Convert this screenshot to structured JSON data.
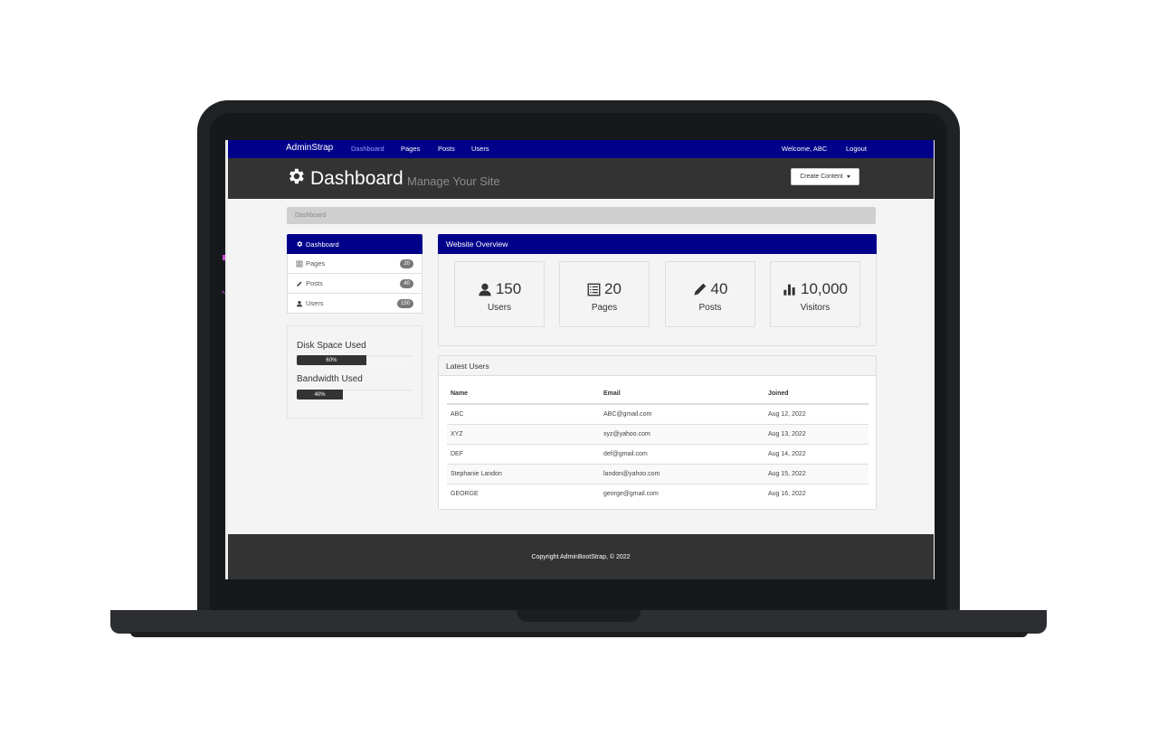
{
  "navbar": {
    "brand": "AdminStrap",
    "links": [
      "Dashboard",
      "Pages",
      "Posts",
      "Users"
    ],
    "welcome": "Welcome, ABC",
    "logout": "Logout"
  },
  "header": {
    "title": "Dashboard",
    "subtitle": "Manage Your Site",
    "create_button": "Create Content"
  },
  "breadcrumb": "Dashboard",
  "sidebar": {
    "items": [
      {
        "label": "Dashboard",
        "icon": "gear-icon"
      },
      {
        "label": "Pages",
        "icon": "list-icon",
        "badge": "20"
      },
      {
        "label": "Posts",
        "icon": "pencil-icon",
        "badge": "40"
      },
      {
        "label": "Users",
        "icon": "user-icon",
        "badge": "150"
      }
    ],
    "disk_label": "Disk Space Used",
    "disk_value": "60%",
    "disk_fraction": 0.6,
    "bandwidth_label": "Bandwidth Used",
    "bandwidth_value": "40%",
    "bandwidth_fraction": 0.4
  },
  "overview": {
    "title": "Website Overview",
    "stats": [
      {
        "value": "150",
        "label": "Users",
        "icon": "user-icon"
      },
      {
        "value": "20",
        "label": "Pages",
        "icon": "list-icon"
      },
      {
        "value": "40",
        "label": "Posts",
        "icon": "pencil-icon"
      },
      {
        "value": "10,000",
        "label": "Visitors",
        "icon": "bar-chart-icon"
      }
    ]
  },
  "latest_users": {
    "title": "Latest Users",
    "columns": [
      "Name",
      "Email",
      "Joined"
    ],
    "rows": [
      [
        "ABC",
        "ABC@gmail.com",
        "Aug 12, 2022"
      ],
      [
        "XYZ",
        "xyz@yahoo.com",
        "Aug 13, 2022"
      ],
      [
        "DEF",
        "def@gmail.com",
        "Aug 14, 2022"
      ],
      [
        "Stephanie Landon",
        "landon@yahoo.com",
        "Aug 15, 2022"
      ],
      [
        "GEORGE",
        "george@gmail.com",
        "Aug 16, 2022"
      ]
    ]
  },
  "footer": "Copyright AdminBootStrap, © 2022",
  "colors": {
    "navbar": "#00008b",
    "header": "#333333",
    "accent": "#00008b"
  }
}
